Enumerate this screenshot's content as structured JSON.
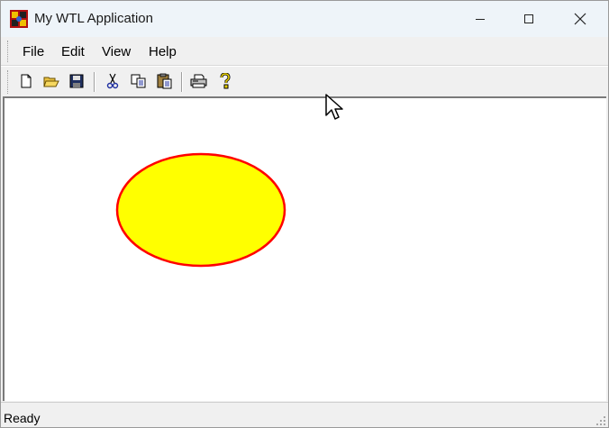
{
  "window": {
    "title": "My WTL Application"
  },
  "menu": {
    "file": "File",
    "edit": "Edit",
    "view": "View",
    "help": "Help"
  },
  "toolbar": {
    "icons": [
      "new-icon",
      "open-icon",
      "save-icon",
      "cut-icon",
      "copy-icon",
      "paste-icon",
      "print-icon",
      "help-icon"
    ]
  },
  "canvas": {
    "shape": "ellipse",
    "fill_color": "#ffff00",
    "stroke_color": "#ff0000"
  },
  "status": {
    "text": "Ready"
  }
}
